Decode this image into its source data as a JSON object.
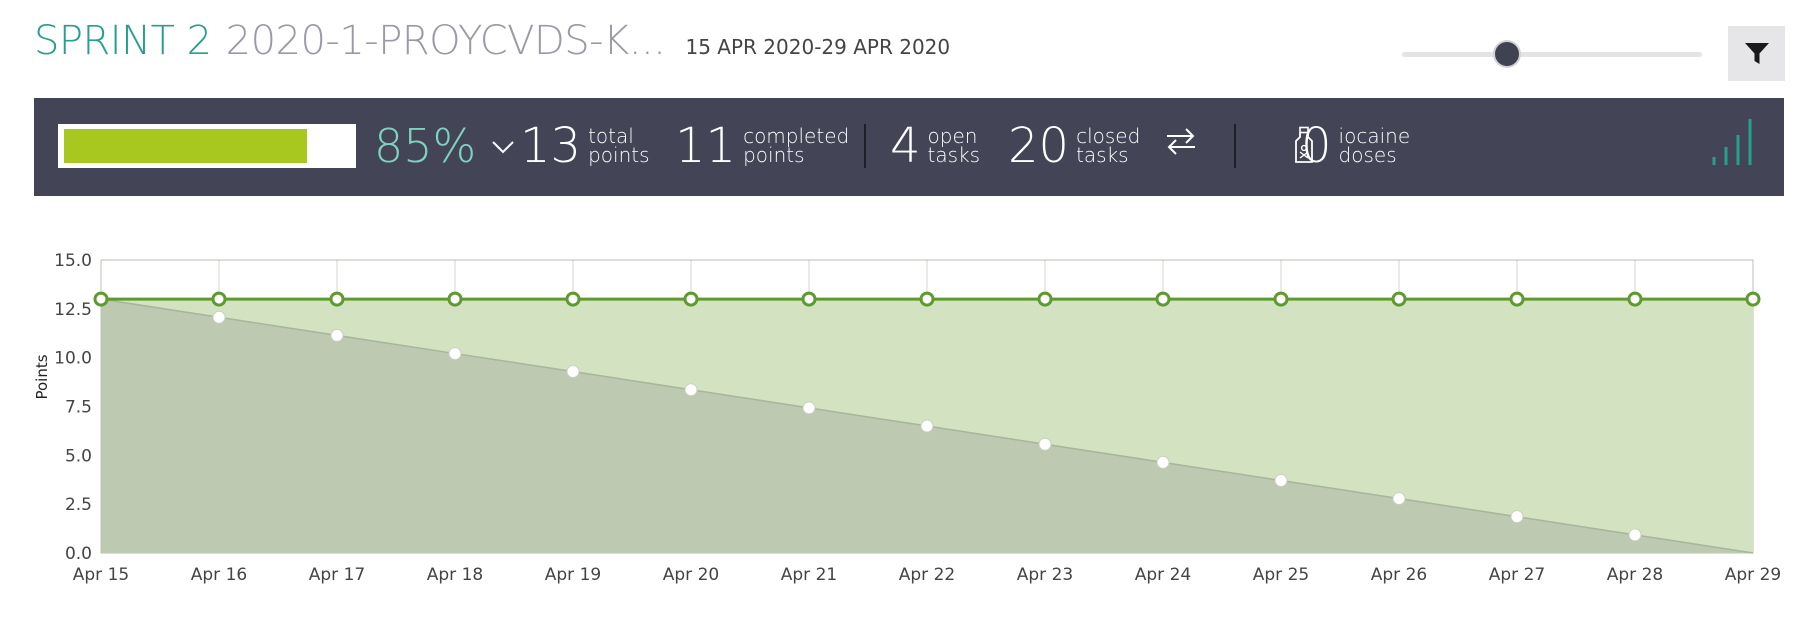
{
  "header": {
    "sprint_name": "SPRINT 2",
    "project_name": "2020-1-PROYCVDS-K...",
    "date_range": "15 APR 2020-29 APR 2020",
    "zoom_level": 0.35
  },
  "summary": {
    "progress_percent": 85,
    "progress_text": "85%",
    "total_points": {
      "value": "13",
      "label_1": "total",
      "label_2": "points"
    },
    "completed_points": {
      "value": "11",
      "label_1": "completed",
      "label_2": "points"
    },
    "open_tasks": {
      "value": "4",
      "label_1": "open",
      "label_2": "tasks"
    },
    "closed_tasks": {
      "value": "20",
      "label_1": "closed",
      "label_2": "tasks"
    },
    "iocaine_doses": {
      "value": "0",
      "label_1": "iocaine",
      "label_2": "doses"
    }
  },
  "icons": {
    "filter": "filter-icon",
    "expand": "chevron-down-icon",
    "swap": "swap-arrows-icon",
    "iocaine": "potion-bottle-icon",
    "graph_toggle": "bar-signal-icon"
  },
  "colors": {
    "accent": "#26a08c",
    "progress": "#a8c820",
    "summary_bg": "#434556",
    "percent": "#7dd3c0",
    "real_line": "#5e9a2e",
    "optimal_area": "#bdc9b0",
    "real_area": "#d3e2c0"
  },
  "chart_data": {
    "type": "area",
    "ylabel": "Points",
    "xlabel": "",
    "ylim": [
      0,
      15
    ],
    "yticks": [
      "0.0",
      "2.5",
      "5.0",
      "7.5",
      "10.0",
      "12.5",
      "15.0"
    ],
    "categories": [
      "Apr 15",
      "Apr 16",
      "Apr 17",
      "Apr 18",
      "Apr 19",
      "Apr 20",
      "Apr 21",
      "Apr 22",
      "Apr 23",
      "Apr 24",
      "Apr 25",
      "Apr 26",
      "Apr 27",
      "Apr 28",
      "Apr 29"
    ],
    "series": [
      {
        "values": [
          13,
          13,
          13,
          13,
          13,
          13,
          13,
          13,
          13,
          13,
          13,
          13,
          13,
          13,
          13
        ]
      },
      {
        "values": [
          13,
          12.07,
          11.14,
          10.21,
          9.29,
          8.36,
          7.43,
          6.5,
          5.57,
          4.64,
          3.71,
          2.79,
          1.86,
          0.93,
          0
        ]
      }
    ],
    "grid": true,
    "legend": "none"
  }
}
